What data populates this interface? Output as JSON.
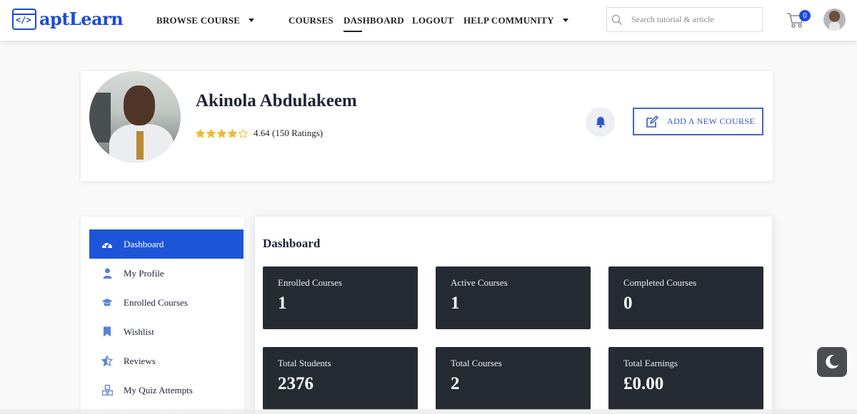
{
  "header": {
    "logo_text": "aptLearn",
    "logo_code": "</>",
    "nav": {
      "browse_course": "BROWSE COURSE",
      "courses": "COURSES",
      "dashboard": "DASHBOARD",
      "logout": "LOGOUT",
      "help_community": "HELP COMMUNITY"
    },
    "search_placeholder": "Search tutorial & article",
    "cart_count": "0"
  },
  "profile": {
    "name": "Akinola Abdulakeem",
    "rating_text": "4.64 (150 Ratings)",
    "rating_value": 4.64,
    "rating_max": 5,
    "add_course_label": "ADD A NEW COURSE"
  },
  "sidebar": {
    "items": [
      {
        "label": "Dashboard",
        "icon": "gauge-icon",
        "active": true
      },
      {
        "label": "My Profile",
        "icon": "user-icon",
        "active": false
      },
      {
        "label": "Enrolled Courses",
        "icon": "graduation-cap-icon",
        "active": false
      },
      {
        "label": "Wishlist",
        "icon": "bookmark-icon",
        "active": false
      },
      {
        "label": "Reviews",
        "icon": "star-half-icon",
        "active": false
      },
      {
        "label": "My Quiz Attempts",
        "icon": "cubes-icon",
        "active": false
      }
    ]
  },
  "dashboard": {
    "title": "Dashboard",
    "stats": [
      {
        "label": "Enrolled Courses",
        "value": "1"
      },
      {
        "label": "Active Courses",
        "value": "1"
      },
      {
        "label": "Completed Courses",
        "value": "0"
      },
      {
        "label": "Total Students",
        "value": "2376"
      },
      {
        "label": "Total Courses",
        "value": "2"
      },
      {
        "label": "Total Earnings",
        "value": "£0.00"
      }
    ]
  },
  "colors": {
    "brand": "#1d4bd6",
    "active_sidebar": "#1d55d8",
    "stat_card": "#262a33",
    "star": "#f2b93b"
  }
}
